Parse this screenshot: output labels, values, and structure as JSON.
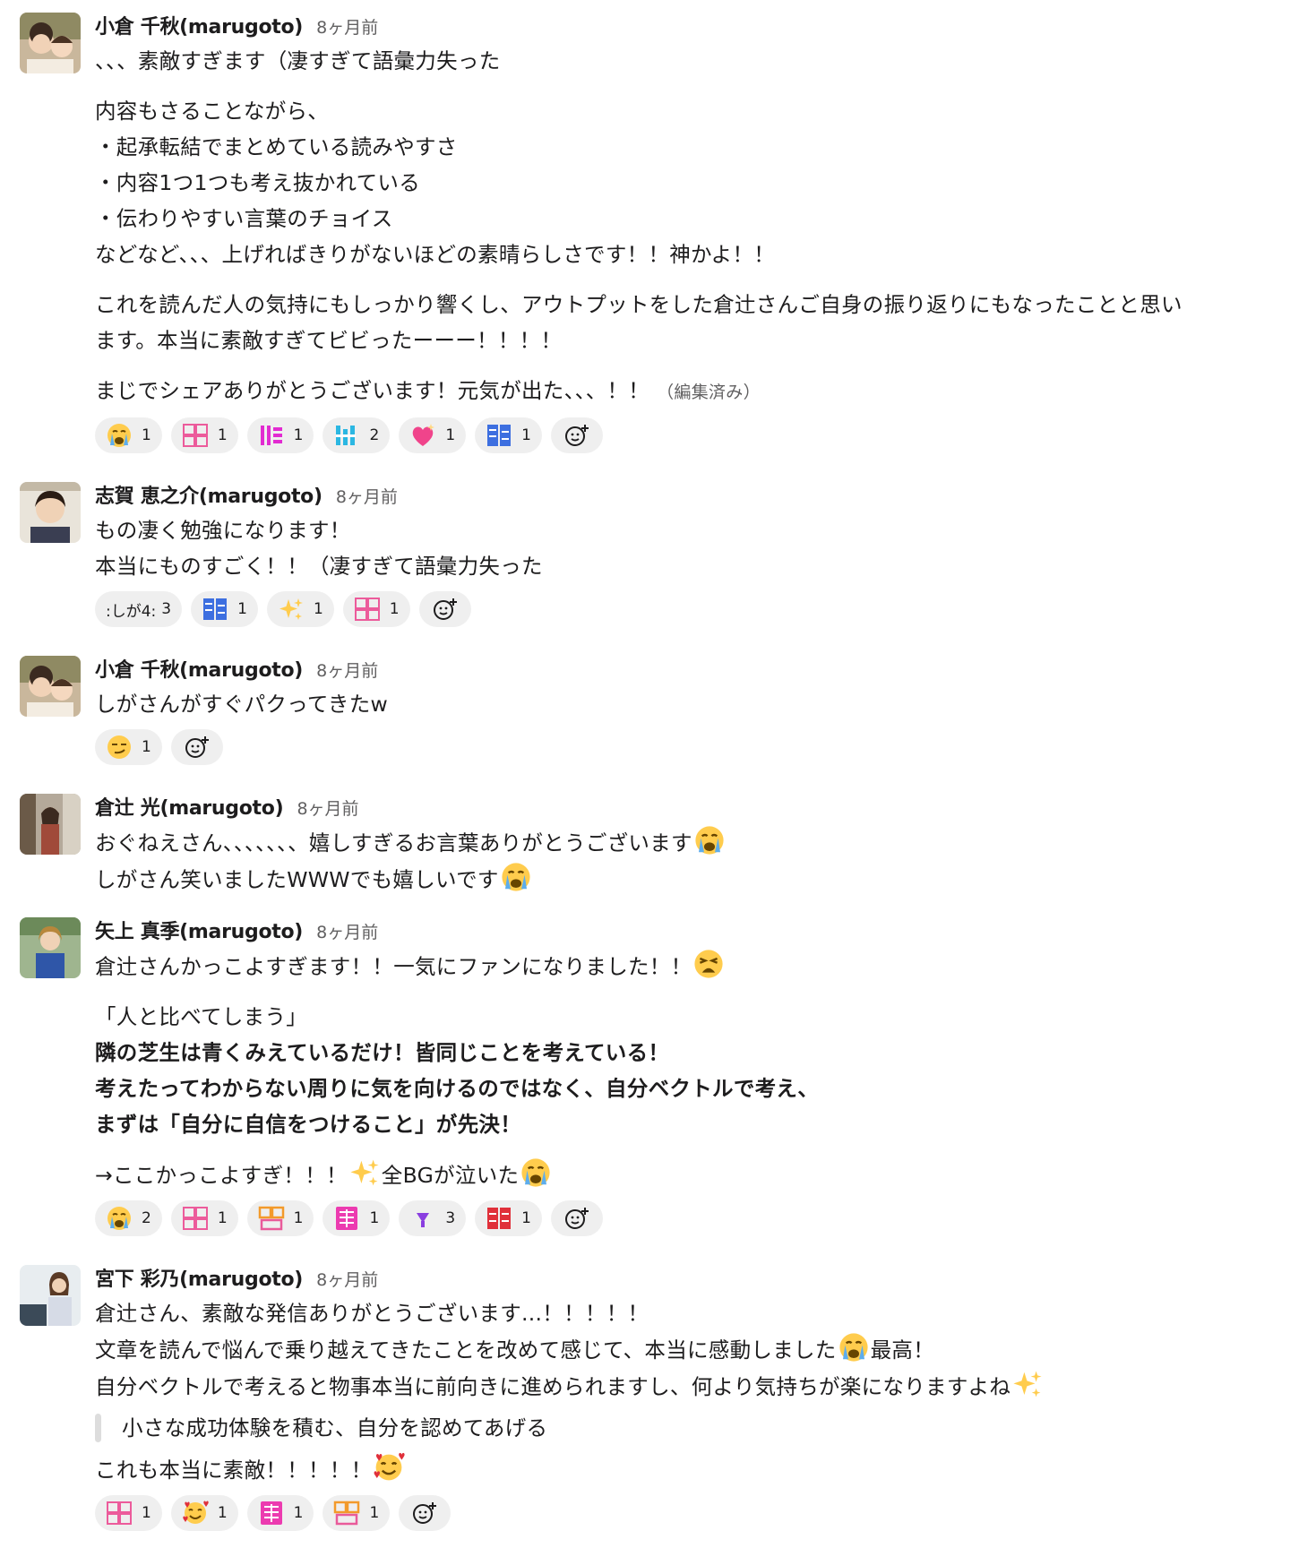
{
  "messages": [
    {
      "sender": "小倉 千秋(marugoto)",
      "time": "8ヶ月前",
      "lines": [
        "、、、素敵すぎます（凄すぎて語彙力失った",
        "内容もさることながら、",
        "・起承転結でまとめている読みやすさ",
        "・内容1つ1つも考え抜かれている",
        "・伝わりやすい言葉のチョイス",
        "などなど、、、上げればきりがないほどの素晴らしさです！！神かよ！！",
        "これを読んだ人の気持にもしっかり響くし、アウトプットをした倉辻さんご自身の振り返りにもなったことと思い",
        "ます。本当に素敵すぎてビビったーーー！！！！",
        "まじでシェアありがとうございます！元気が出た、、、！！"
      ],
      "edited": "（編集済み）",
      "reactions": [
        {
          "emoji": "crying-face",
          "count": "1"
        },
        {
          "emoji": "custom-pink-text",
          "count": "1"
        },
        {
          "emoji": "custom-magenta-text",
          "count": "1"
        },
        {
          "emoji": "custom-cyan-text",
          "count": "2"
        },
        {
          "emoji": "sparkling-heart",
          "count": "1"
        },
        {
          "emoji": "custom-blue-kanji",
          "count": "1"
        }
      ]
    },
    {
      "sender": "志賀 恵之介(marugoto)",
      "time": "8ヶ月前",
      "lines": [
        "もの凄く勉強になります！",
        "本当にものすごく！！（凄すぎて語彙力失った"
      ],
      "reactions": [
        {
          "label": ":しが4:",
          "count": "3"
        },
        {
          "emoji": "custom-blue-kanji",
          "count": "1"
        },
        {
          "emoji": "sparkles",
          "count": "1"
        },
        {
          "emoji": "custom-pink-text",
          "count": "1"
        }
      ]
    },
    {
      "sender": "小倉 千秋(marugoto)",
      "time": "8ヶ月前",
      "lines": [
        "しがさんがすぐパクってきたw"
      ],
      "reactions": [
        {
          "emoji": "smirking-face",
          "count": "1"
        }
      ]
    },
    {
      "sender": "倉辻 光(marugoto)",
      "time": "8ヶ月前",
      "lines": [
        "おぐねえさん、、、、、、、嬉しすぎるお言葉ありがとうございます",
        "しがさん笑いましたWWWでも嬉しいです"
      ]
    },
    {
      "sender": "矢上 真季(marugoto)",
      "time": "8ヶ月前",
      "lines": [
        "倉辻さんかっこよすぎます！！一気にファンになりました！！",
        "「人と比べてしまう」",
        "隣の芝生は青くみえているだけ！皆同じことを考えている！",
        "考えたってわからない周りに気を向けるのではなく、自分ベクトルで考え、",
        "まずは「自分に自信をつけること」が先決！",
        "→ここかっこよすぎ！！！",
        "全BGが泣いた"
      ],
      "reactions": [
        {
          "emoji": "crying-face",
          "count": "2"
        },
        {
          "emoji": "custom-pink-text",
          "count": "1"
        },
        {
          "emoji": "custom-orange-text",
          "count": "1"
        },
        {
          "emoji": "custom-magenta-kanji",
          "count": "1"
        },
        {
          "emoji": "custom-purple-text",
          "count": "3"
        },
        {
          "emoji": "custom-red-kanji",
          "count": "1"
        }
      ]
    },
    {
      "sender": "宮下 彩乃(marugoto)",
      "time": "8ヶ月前",
      "lines": [
        "倉辻さん、素敵な発信ありがとうございます...！！！！！",
        "文章を読んで悩んで乗り越えてきたことを改めて感じて、本当に感動しました",
        "最高！",
        "自分ベクトルで考えると物事本当に前向きに進められますし、何より気持ちが楽になりますよね",
        "小さな成功体験を積む、自分を認めてあげる",
        "これも本当に素敵！！！！！"
      ],
      "reactions": [
        {
          "emoji": "custom-pink-text",
          "count": "1"
        },
        {
          "emoji": "smiling-face-with-hearts",
          "count": "1"
        },
        {
          "emoji": "custom-magenta-kanji",
          "count": "1"
        },
        {
          "emoji": "custom-orange-text",
          "count": "1"
        }
      ]
    }
  ]
}
